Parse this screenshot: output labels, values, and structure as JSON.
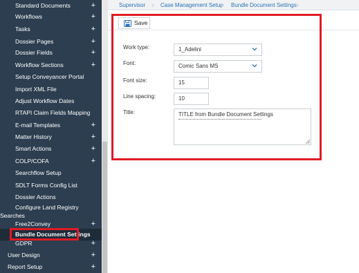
{
  "sidebar": {
    "items": [
      {
        "label": "Standard Documents",
        "expandable": true
      },
      {
        "label": "Workflows",
        "expandable": true
      },
      {
        "label": "Tasks",
        "expandable": true
      },
      {
        "label": "Dossier Pages",
        "expandable": true
      },
      {
        "label": "Dossier Fields",
        "expandable": true
      },
      {
        "label": "Workflow Sections",
        "expandable": true
      },
      {
        "label": "Setup Conveyancer Portal",
        "expandable": false
      },
      {
        "label": "Import XML File",
        "expandable": false
      },
      {
        "label": "Adjust Workflow Dates",
        "expandable": false
      },
      {
        "label": "RTAPI Claim Fields Mapping",
        "expandable": false
      },
      {
        "label": "E-mail Templates",
        "expandable": true
      },
      {
        "label": "Matter History",
        "expandable": true
      },
      {
        "label": "Smart Actions",
        "expandable": true
      },
      {
        "label": "COLP/COFA",
        "expandable": true
      },
      {
        "label": "Searchflow Setup",
        "expandable": false
      },
      {
        "label": "SDLT Forms Config List",
        "expandable": false
      },
      {
        "label": "Dossier Actions",
        "expandable": false
      },
      {
        "label": "Configure Land Registry",
        "label2": "Searches",
        "expandable": false
      },
      {
        "label": "Free2Convey",
        "expandable": true
      },
      {
        "label": "Bundle Document Settings",
        "expandable": false,
        "active": true
      },
      {
        "label": "GDPR",
        "expandable": true
      },
      {
        "label": "User Design",
        "expandable": true
      },
      {
        "label": "Report Setup",
        "expandable": true
      }
    ],
    "plus_glyph": "+"
  },
  "breadcrumb": {
    "items": [
      "Supervisor",
      "Case Management Setup",
      "Bundle Document Settings"
    ]
  },
  "toolbar": {
    "save_label": "Save",
    "save_icon": "floppy-disk-icon"
  },
  "form": {
    "work_type": {
      "label": "Work type:",
      "value": "1_Adelini"
    },
    "font": {
      "label": "Font:",
      "value": "Comic Sans MS"
    },
    "font_size": {
      "label": "Font size:",
      "value": "15"
    },
    "line_spacing": {
      "label": "Line spacing:",
      "value": "10"
    },
    "title": {
      "label": "Title:",
      "value": "TITLE from Bundle Document Settings"
    }
  },
  "colors": {
    "sidebar_bg": "#2c3e50",
    "highlight": "#e01b24",
    "link": "#2b73b7"
  }
}
